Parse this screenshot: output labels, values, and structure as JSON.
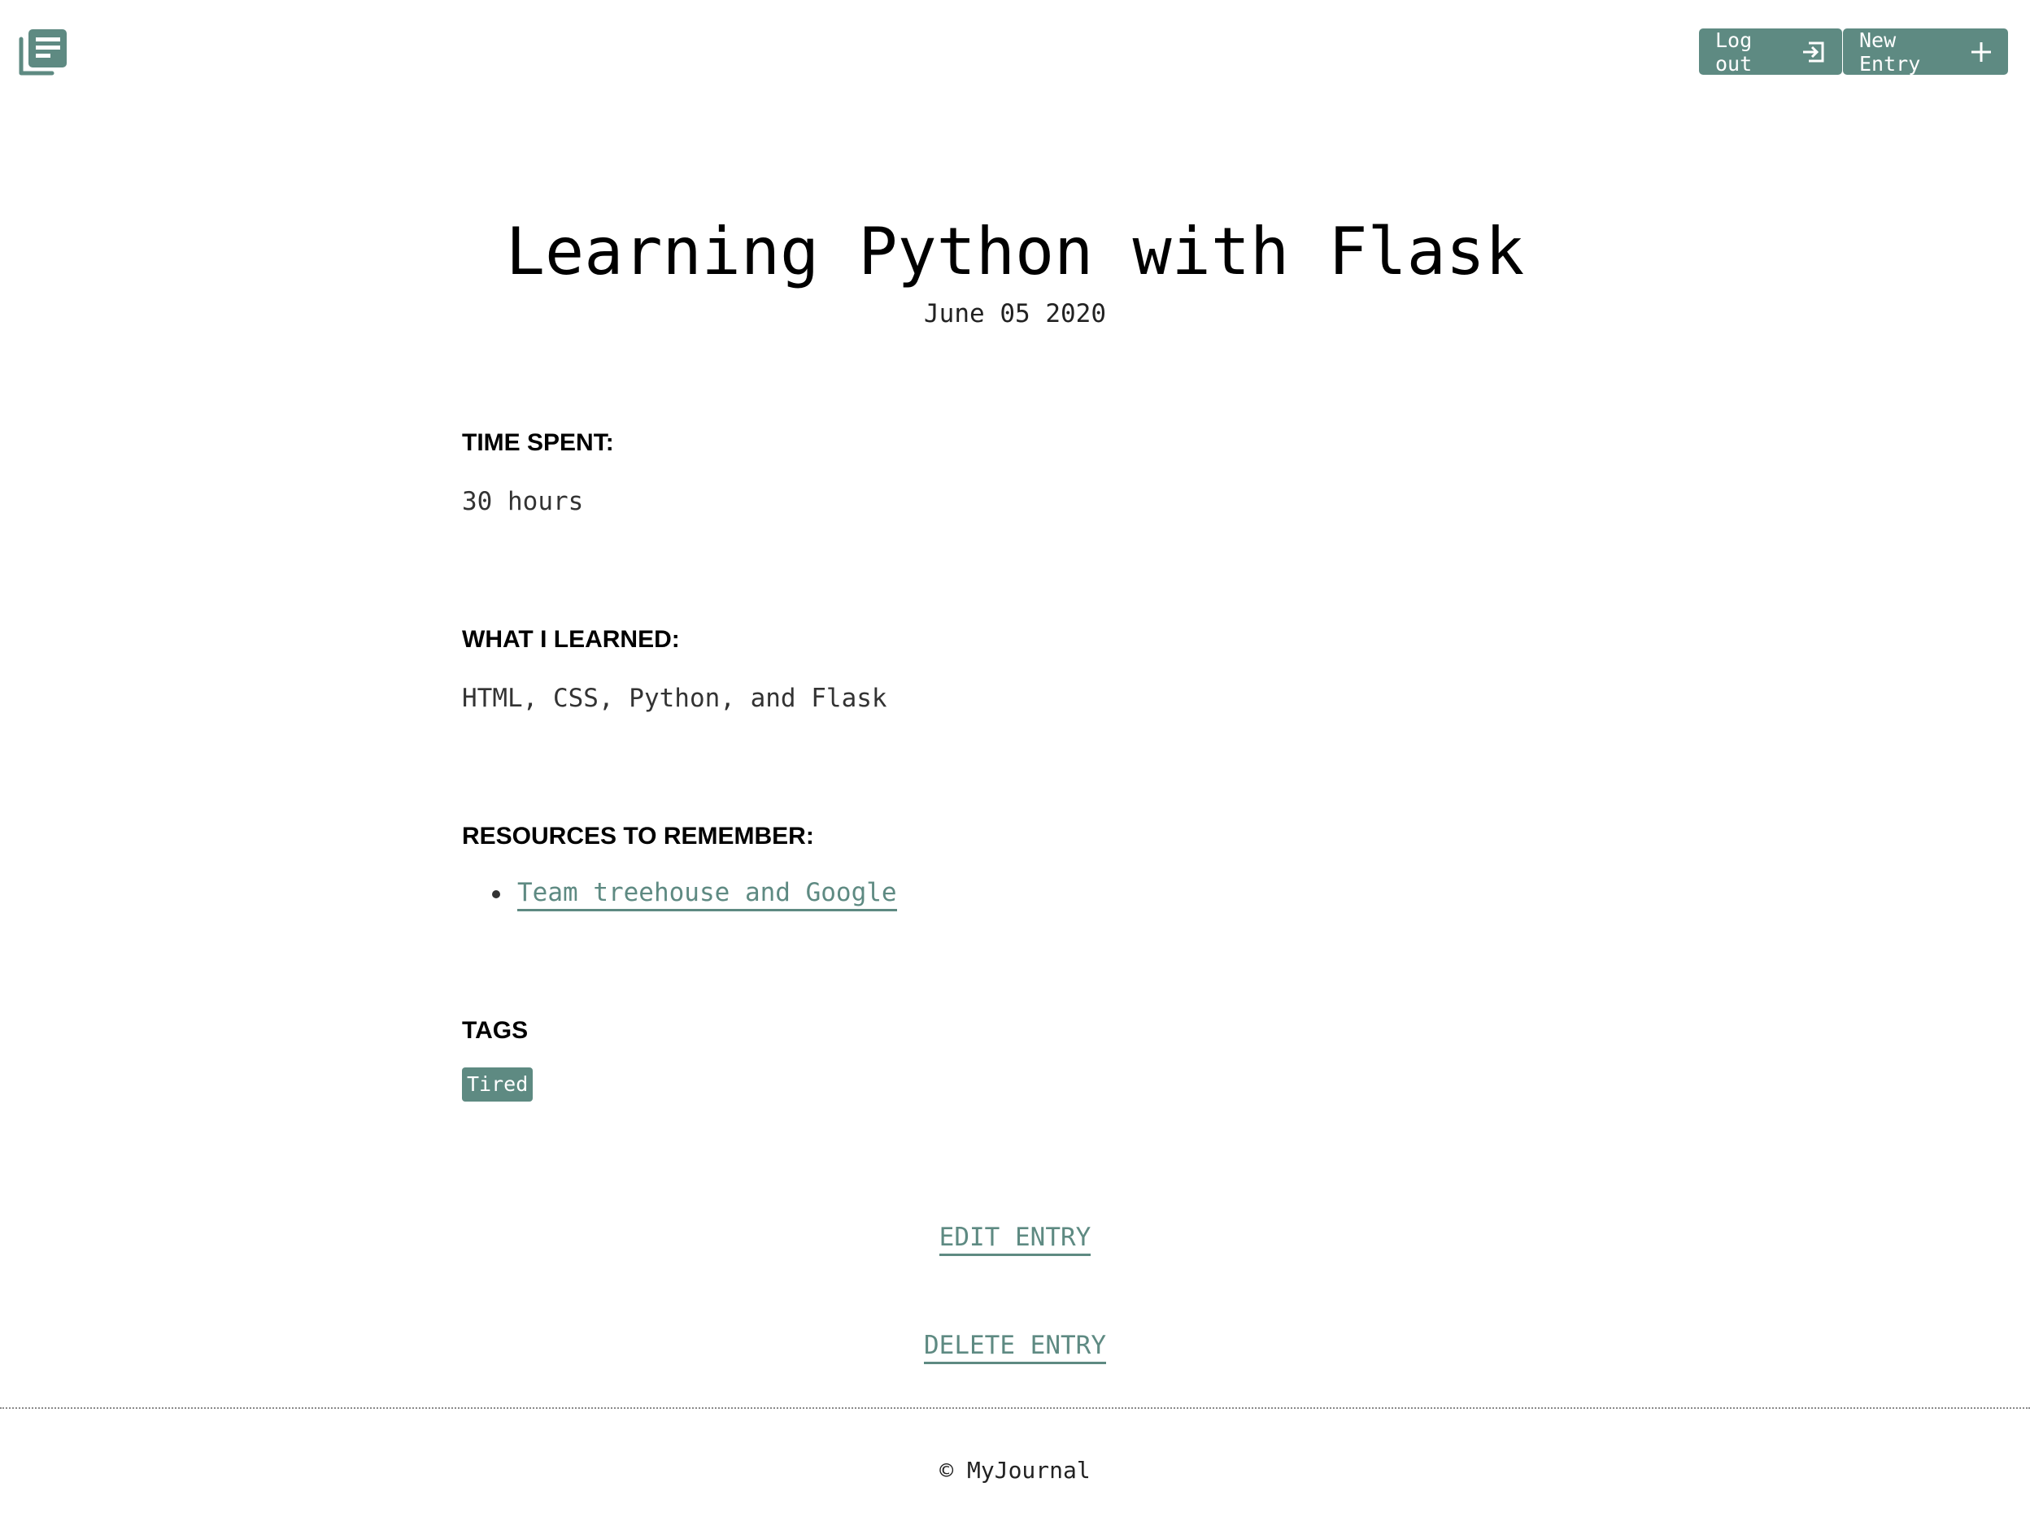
{
  "brand": {
    "icon": "journal-icon",
    "color": "#5e8a82"
  },
  "header": {
    "logout_label": "Log out",
    "logout_icon": "logout-icon",
    "new_entry_label": "New Entry",
    "new_entry_icon": "plus-icon"
  },
  "entry": {
    "title": "Learning Python with Flask",
    "date": "June 05 2020",
    "time_spent_label": "TIME SPENT:",
    "time_spent": "30 hours",
    "learned_label": "WHAT I LEARNED:",
    "learned": "HTML, CSS, Python, and Flask",
    "resources_label": "RESOURCES TO REMEMBER:",
    "resources": [
      {
        "label": "Team treehouse and Google"
      }
    ],
    "tags_label": "TAGS",
    "tags": [
      {
        "label": "Tired"
      }
    ]
  },
  "actions": {
    "edit_label": "EDIT ENTRY",
    "delete_label": "DELETE ENTRY"
  },
  "footer": {
    "text": "© MyJournal"
  }
}
